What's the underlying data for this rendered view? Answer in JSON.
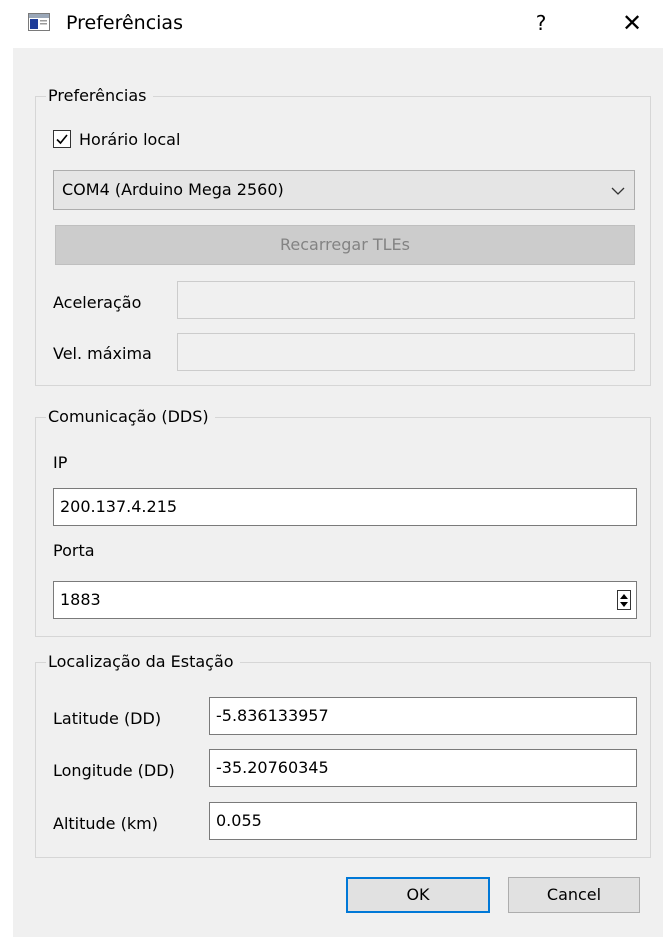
{
  "window": {
    "title": "Preferências",
    "help_glyph": "?",
    "close_glyph": "✕",
    "icon": "window-app-icon"
  },
  "preferences_group": {
    "title": "Preferências",
    "local_time": {
      "label": "Horário local",
      "checked": true
    },
    "port_select": {
      "value": "COM4 (Arduino Mega 2560)",
      "icon": "chevron-down-icon"
    },
    "reload_tles_button": {
      "label": "Recarregar TLEs",
      "enabled": false
    },
    "acceleration": {
      "label": "Aceleração",
      "value": ""
    },
    "max_velocity": {
      "label": "Vel. máxima",
      "value": ""
    }
  },
  "communication_group": {
    "title": "Comunicação (DDS)",
    "ip": {
      "label": "IP",
      "value": "200.137.4.215"
    },
    "port": {
      "label": "Porta",
      "value": "1883"
    }
  },
  "station_group": {
    "title": "Localização da Estação",
    "latitude": {
      "label": "Latitude (DD)",
      "value": "-5.836133957"
    },
    "longitude": {
      "label": "Longitude (DD)",
      "value": "-35.20760345"
    },
    "altitude": {
      "label": "Altitude (km)",
      "value": "0.055"
    }
  },
  "buttons": {
    "ok": "OK",
    "cancel": "Cancel"
  },
  "colors": {
    "accent": "#0078d7",
    "dialog_bg": "#f0f0f0",
    "disabled_button": "#cccccc"
  }
}
